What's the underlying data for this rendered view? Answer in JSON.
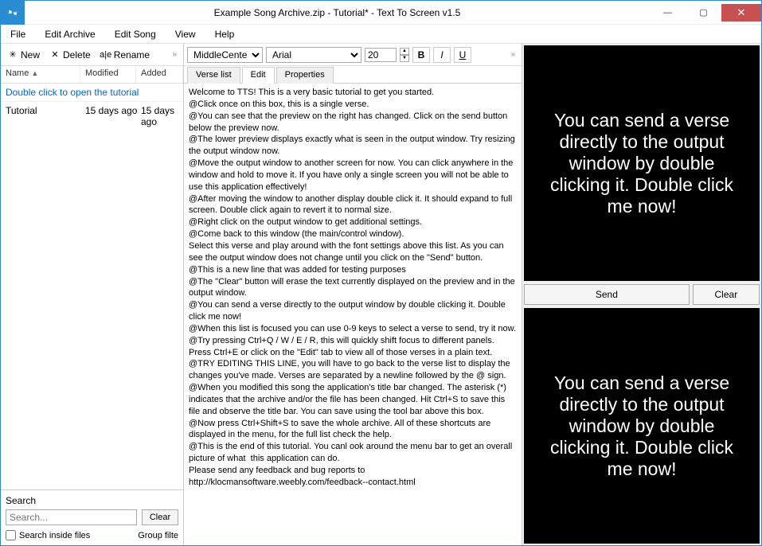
{
  "window": {
    "title": "Example Song Archive.zip - Tutorial* - Text To Screen v1.5",
    "minimize": "—",
    "maximize": "▢",
    "close": "✕"
  },
  "menu": {
    "file": "File",
    "edit_archive": "Edit Archive",
    "edit_song": "Edit Song",
    "view": "View",
    "help": "Help"
  },
  "left_toolbar": {
    "new": "New",
    "delete": "Delete",
    "rename": "Rename",
    "overflow": "»"
  },
  "list": {
    "headers": {
      "name": "Name",
      "modified": "Modified",
      "added": "Added"
    },
    "hint": "Double click to open the tutorial",
    "rows": [
      {
        "name": "Tutorial",
        "modified": "15 days ago",
        "added": "15 days ago"
      }
    ]
  },
  "search": {
    "label": "Search",
    "placeholder": "Search...",
    "clear": "Clear",
    "inside_files": "Search inside files",
    "group_filter": "Group filte"
  },
  "mid_toolbar": {
    "align": "MiddleCenter",
    "font": "Arial",
    "size": "20",
    "bold": "B",
    "italic": "I",
    "underline": "U",
    "overflow": "»"
  },
  "tabs": {
    "verse_list": "Verse list",
    "edit": "Edit",
    "properties": "Properties"
  },
  "editor_text": "Welcome to TTS! This is a very basic tutorial to get you started.\n@Click once on this box, this is a single verse.\n@You can see that the preview on the right has changed. Click on the send button below the preview now.\n@The lower preview displays exactly what is seen in the output window. Try resizing the output window now.\n@Move the output window to another screen for now. You can click anywhere in the window and hold to move it. If you have only a single screen you will not be able to use this application effectively!\n@After moving the window to another display double click it. It should expand to full screen. Double click again to revert it to normal size.\n@Right click on the output window to get additional settings.\n@Come back to this window (the main/control window).\nSelect this verse and play around with the font settings above this list. As you can see the output window does not change until you click on the \"Send\" button.\n@This is a new line that was added for testing purposes\n@The \"Clear\" button will erase the text currently displayed on the preview and in the output window.\n@You can send a verse directly to the output window by double clicking it. Double click me now!\n@When this list is focused you can use 0-9 keys to select a verse to send, try it now.\n@Try pressing Ctrl+Q / W / E / R, this will quickly shift focus to different panels. Press Ctrl+E or click on the \"Edit\" tab to view all of those verses in a plain text.\n@TRY EDITING THIS LINE, you will have to go back to the verse list to display the changes you've made. Verses are separated by a newline followed by the @ sign.\n@When you modified this song the application's title bar changed. The asterisk (*) indicates that the archive and/or the file has been changed. Hit Ctrl+S to save this file and observe the title bar. You can save using the tool bar above this box.\n@Now press Ctrl+Shift+S to save the whole archive. All of these shortcuts are displayed in the menu, for the full list check the help.\n@This is the end of this tutorial. You canl ook around the menu bar to get an overall picture of what  this application can do.\nPlease send any feedback and bug reports to http://klocmansoftware.weebly.com/feedback--contact.html",
  "right": {
    "preview_text": "You can send a verse directly to the output window by double clicking it. Double click me now!",
    "send": "Send",
    "clear": "Clear",
    "output_text": "You can send a verse directly to the output window by double clicking it. Double click me now!"
  }
}
